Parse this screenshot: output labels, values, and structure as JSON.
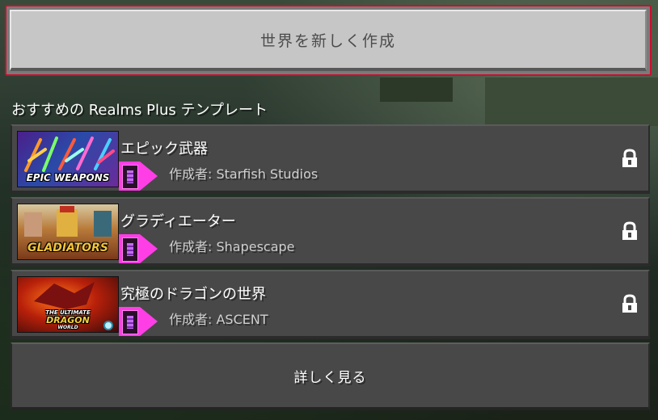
{
  "create_button": {
    "label": "世界を新しく作成"
  },
  "section": {
    "title": "おすすめの Realms Plus テンプレート"
  },
  "templates": [
    {
      "title": "エピック武器",
      "author": "作成者: Starfish Studios",
      "thumb_text": "EPIC WEAPONS",
      "thumb_icon": "epic-weapons-thumbnail",
      "locked": true
    },
    {
      "title": "グラディエーター",
      "author": "作成者: Shapescape",
      "thumb_text": "GLADIATORS",
      "thumb_icon": "gladiators-thumbnail",
      "locked": true
    },
    {
      "title": "究極のドラゴンの世界",
      "author": "作成者: ASCENT",
      "thumb_text_lines": [
        "THE ULTIMATE",
        "DRAGON",
        "WORLD"
      ],
      "thumb_icon": "dragon-world-thumbnail",
      "locked": true
    }
  ],
  "more_button": {
    "label": "詳しく見る"
  },
  "colors": {
    "accent_border": "#c8102e",
    "badge": "#ff3ee6",
    "row_bg": "#484848",
    "button_light": "#c6c6c6"
  },
  "icons": {
    "lock": "lock-icon",
    "badge": "realms-plus-badge-icon"
  }
}
